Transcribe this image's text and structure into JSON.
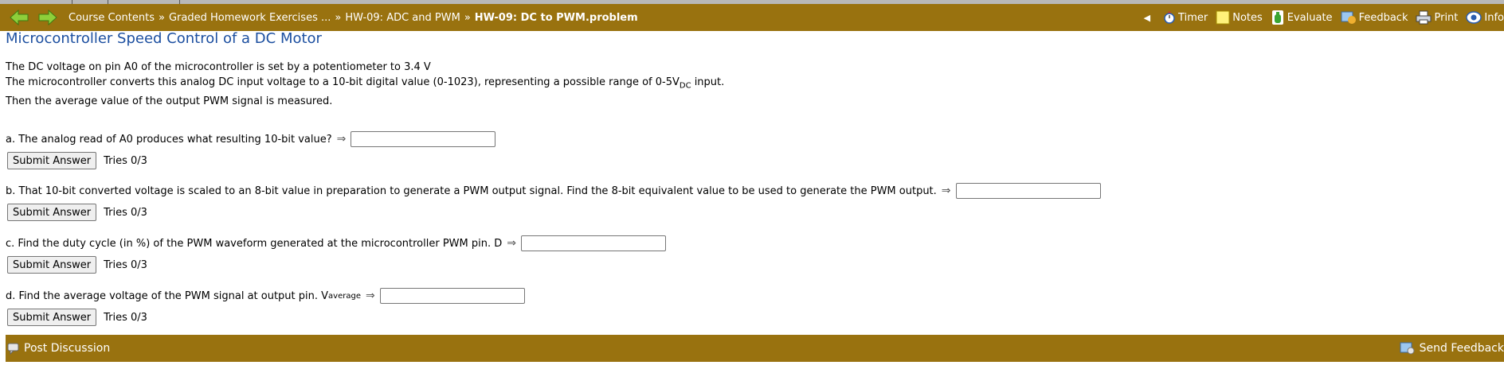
{
  "nav": {
    "breadcrumbs": [
      "Course Contents",
      "Graded Homework Exercises ...",
      "HW-09: ADC and PWM",
      "HW-09: DC to PWM.problem"
    ],
    "separator": "»",
    "tools": [
      "Timer",
      "Notes",
      "Evaluate",
      "Feedback",
      "Print",
      "Info"
    ]
  },
  "page": {
    "title": "Microcontroller Speed Control of a DC Motor",
    "intro": {
      "line1": "The DC voltage on pin A0 of the microcontroller is set by a potentiometer to 3.4 V",
      "line2_pre": "The microcontroller converts this analog DC input voltage to a 10-bit digital value (0-1023), representing a possible range of 0-5V",
      "line2_sub": "DC",
      "line2_post": " input.",
      "line3": "Then the average value of the output PWM signal is measured."
    }
  },
  "questions": [
    {
      "text": "a. The analog read of A0 produces what resulting 10-bit value?",
      "sub": "",
      "value": "",
      "button": "Submit Answer",
      "tries": "Tries 0/3"
    },
    {
      "text": "b. That 10-bit converted voltage is scaled to an 8-bit value in preparation to generate a PWM output signal. Find the 8-bit equivalent value to be used to generate the PWM output.",
      "sub": "",
      "value": "",
      "button": "Submit Answer",
      "tries": "Tries 0/3"
    },
    {
      "text": "c. Find the duty cycle (in %) of the PWM waveform generated at the microcontroller PWM pin. D",
      "sub": "",
      "value": "",
      "button": "Submit Answer",
      "tries": "Tries 0/3"
    },
    {
      "text": "d. Find the average voltage of the PWM signal at output pin. V",
      "sub": "average",
      "value": "",
      "button": "Submit Answer",
      "tries": "Tries 0/3"
    }
  ],
  "arrow_glyph": "⇒",
  "footer": {
    "left": "Post Discussion",
    "right": "Send Feedback"
  },
  "colors": {
    "bar": "#99720f",
    "title": "#1c4fa0",
    "nav_arrows": "#8ecf3a"
  },
  "icons": [
    "back-arrow-icon",
    "forward-arrow-icon",
    "timer-icon",
    "notes-icon",
    "evaluate-icon",
    "feedback-icon",
    "print-icon",
    "info-icon",
    "discussion-icon",
    "send-feedback-icon"
  ]
}
